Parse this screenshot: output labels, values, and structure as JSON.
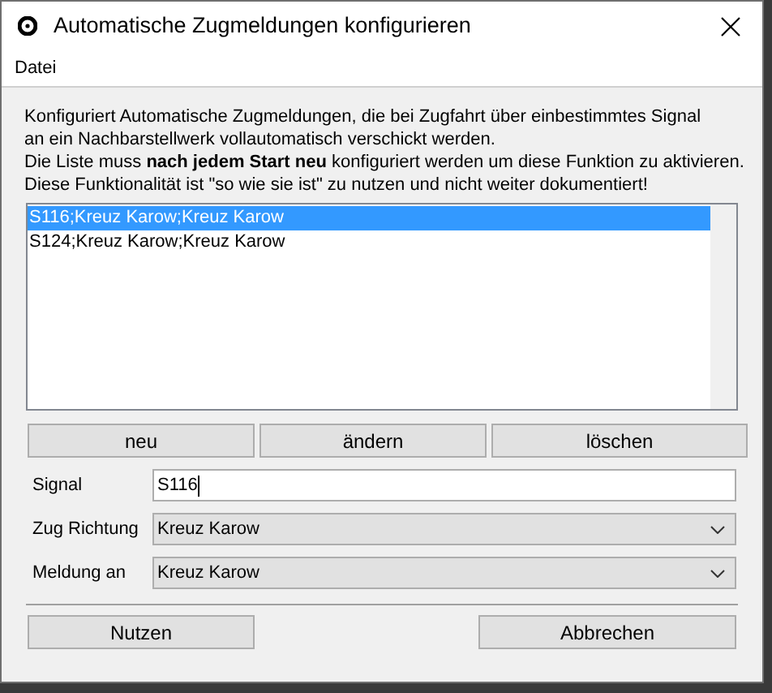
{
  "window": {
    "title": "Automatische Zugmeldungen konfigurieren"
  },
  "menu": [
    "Datei"
  ],
  "description": [
    "Konfiguriert Automatische Zugmeldungen, die bei Zugfahrt über einbestimmtes Signal",
    "an ein Nachbarstellwerk vollautomatisch verschickt werden.",
    "Die Liste muss **nach jedem Start neu** konfiguriert werden um diese Funktion zu aktivieren.",
    "Diese Funktionalität ist \"so wie sie ist\" zu nutzen und nicht weiter dokumentiert!"
  ],
  "list": [
    {
      "text": "S116;Kreuz Karow;Kreuz Karow",
      "selected": true
    },
    {
      "text": "S124;Kreuz Karow;Kreuz Karow",
      "selected": false
    }
  ],
  "list_buttons": [
    "neu",
    "ändern",
    "löschen"
  ],
  "form": [
    {
      "kind": "text",
      "label": "Signal",
      "value": "S116"
    },
    {
      "kind": "select",
      "label": "Zug Richtung",
      "value": "Kreuz Karow"
    },
    {
      "kind": "select",
      "label": "Meldung an",
      "value": "Kreuz Karow"
    }
  ],
  "buttons": [
    "Nutzen",
    "Abbrechen"
  ]
}
